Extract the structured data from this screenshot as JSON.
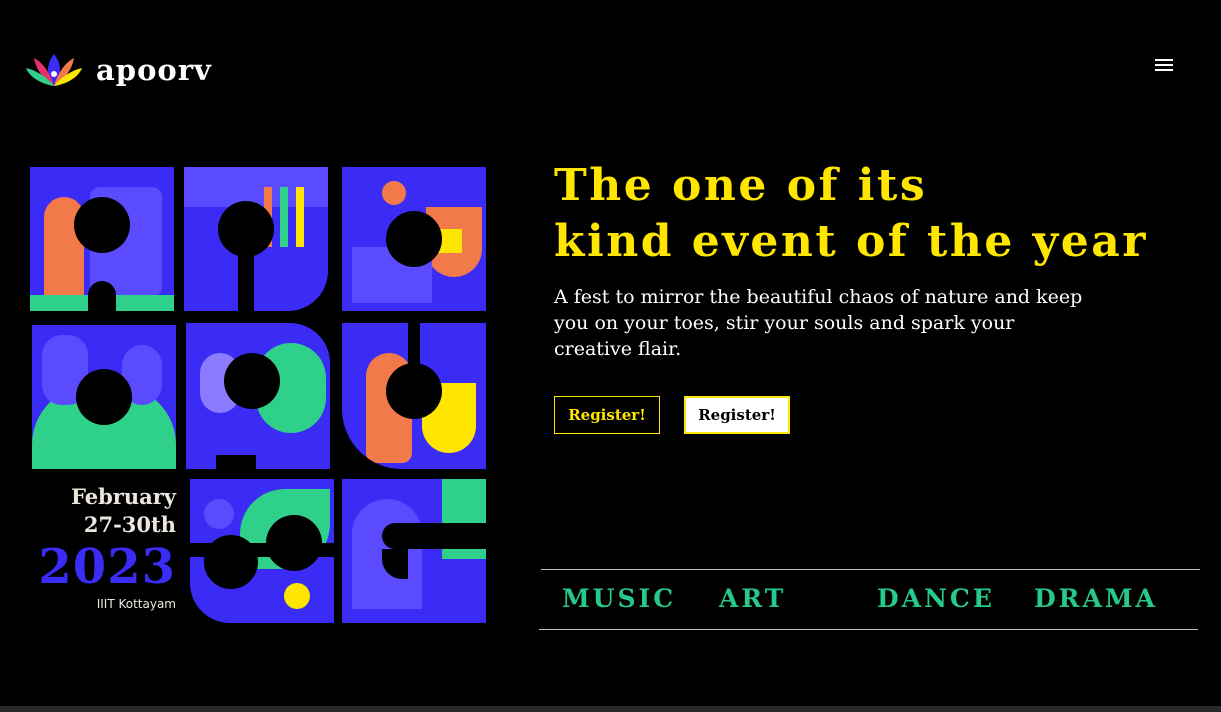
{
  "header": {
    "logo_text": "apoorv",
    "logo_icon": "lotus-logo-icon",
    "menu_icon": "hamburger-menu-icon"
  },
  "poster": {
    "month": "February",
    "days": "27-30th",
    "year": "2023",
    "place": "IIIT Kottayam",
    "colors": {
      "blue": "#3b2cf5",
      "green": "#2fd08a",
      "orange": "#f27a4a",
      "yellow": "#ffe600"
    }
  },
  "hero": {
    "headline_line1": "The one of its",
    "headline_line2": "kind event of the year",
    "tagline": "A fest to mirror the beautiful chaos of nature and keep you on your toes, stir your souls and spark your creative flair.",
    "register_outline": "Register!",
    "register_solid": "Register!"
  },
  "categories": [
    "MUSIC",
    "ART",
    "DANCE",
    "DRAMA"
  ],
  "colors": {
    "headline": "#ffe600",
    "category": "#27c98a",
    "background": "#000000"
  }
}
